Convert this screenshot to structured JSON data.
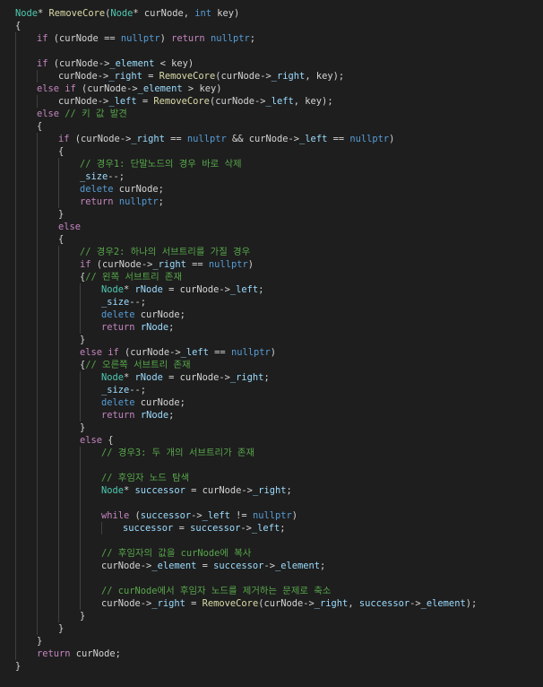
{
  "editor": {
    "lines": [
      {
        "indent": 0,
        "tokens": [
          {
            "t": "Node",
            "k": "type"
          },
          {
            "t": "* ",
            "k": "plain"
          },
          {
            "t": "RemoveCore",
            "k": "func"
          },
          {
            "t": "(",
            "k": "plain"
          },
          {
            "t": "Node",
            "k": "type"
          },
          {
            "t": "* curNode, ",
            "k": "plain"
          },
          {
            "t": "int",
            "k": "kw"
          },
          {
            "t": " key)",
            "k": "plain"
          }
        ]
      },
      {
        "indent": 0,
        "tokens": [
          {
            "t": "{",
            "k": "plain"
          }
        ]
      },
      {
        "indent": 1,
        "tokens": [
          {
            "t": "if",
            "k": "ctrl"
          },
          {
            "t": " (curNode == ",
            "k": "plain"
          },
          {
            "t": "nullptr",
            "k": "kw"
          },
          {
            "t": ") ",
            "k": "plain"
          },
          {
            "t": "return",
            "k": "ctrl"
          },
          {
            "t": " ",
            "k": "plain"
          },
          {
            "t": "nullptr",
            "k": "kw"
          },
          {
            "t": ";",
            "k": "plain"
          }
        ]
      },
      {
        "indent": 1,
        "tokens": []
      },
      {
        "indent": 1,
        "tokens": [
          {
            "t": "if",
            "k": "ctrl"
          },
          {
            "t": " (curNode->",
            "k": "plain"
          },
          {
            "t": "_element",
            "k": "var"
          },
          {
            "t": " < key)",
            "k": "plain"
          }
        ]
      },
      {
        "indent": 2,
        "tokens": [
          {
            "t": "curNode->",
            "k": "plain"
          },
          {
            "t": "_right",
            "k": "var"
          },
          {
            "t": " = ",
            "k": "plain"
          },
          {
            "t": "RemoveCore",
            "k": "func"
          },
          {
            "t": "(curNode->",
            "k": "plain"
          },
          {
            "t": "_right",
            "k": "var"
          },
          {
            "t": ", key);",
            "k": "plain"
          }
        ]
      },
      {
        "indent": 1,
        "tokens": [
          {
            "t": "else if",
            "k": "ctrl"
          },
          {
            "t": " (curNode->",
            "k": "plain"
          },
          {
            "t": "_element",
            "k": "var"
          },
          {
            "t": " > key)",
            "k": "plain"
          }
        ]
      },
      {
        "indent": 2,
        "tokens": [
          {
            "t": "curNode->",
            "k": "plain"
          },
          {
            "t": "_left",
            "k": "var"
          },
          {
            "t": " = ",
            "k": "plain"
          },
          {
            "t": "RemoveCore",
            "k": "func"
          },
          {
            "t": "(curNode->",
            "k": "plain"
          },
          {
            "t": "_left",
            "k": "var"
          },
          {
            "t": ", key);",
            "k": "plain"
          }
        ]
      },
      {
        "indent": 1,
        "tokens": [
          {
            "t": "else",
            "k": "ctrl"
          },
          {
            "t": " ",
            "k": "plain"
          },
          {
            "t": "// 키 값 발견",
            "k": "cmt"
          }
        ]
      },
      {
        "indent": 1,
        "tokens": [
          {
            "t": "{",
            "k": "plain"
          }
        ]
      },
      {
        "indent": 2,
        "tokens": [
          {
            "t": "if",
            "k": "ctrl"
          },
          {
            "t": " (curNode->",
            "k": "plain"
          },
          {
            "t": "_right",
            "k": "var"
          },
          {
            "t": " == ",
            "k": "plain"
          },
          {
            "t": "nullptr",
            "k": "kw"
          },
          {
            "t": " && curNode->",
            "k": "plain"
          },
          {
            "t": "_left",
            "k": "var"
          },
          {
            "t": " == ",
            "k": "plain"
          },
          {
            "t": "nullptr",
            "k": "kw"
          },
          {
            "t": ")",
            "k": "plain"
          }
        ]
      },
      {
        "indent": 2,
        "tokens": [
          {
            "t": "{",
            "k": "plain"
          }
        ]
      },
      {
        "indent": 3,
        "tokens": [
          {
            "t": "// 경우1: 단말노드의 경우 바로 삭제",
            "k": "cmt"
          }
        ]
      },
      {
        "indent": 3,
        "tokens": [
          {
            "t": "_size",
            "k": "var"
          },
          {
            "t": "--;",
            "k": "plain"
          }
        ]
      },
      {
        "indent": 3,
        "tokens": [
          {
            "t": "delete",
            "k": "kw"
          },
          {
            "t": " curNode;",
            "k": "plain"
          }
        ]
      },
      {
        "indent": 3,
        "tokens": [
          {
            "t": "return",
            "k": "ctrl"
          },
          {
            "t": " ",
            "k": "plain"
          },
          {
            "t": "nullptr",
            "k": "kw"
          },
          {
            "t": ";",
            "k": "plain"
          }
        ]
      },
      {
        "indent": 2,
        "tokens": [
          {
            "t": "}",
            "k": "plain"
          }
        ]
      },
      {
        "indent": 2,
        "tokens": [
          {
            "t": "else",
            "k": "ctrl"
          }
        ]
      },
      {
        "indent": 2,
        "tokens": [
          {
            "t": "{",
            "k": "plain"
          }
        ]
      },
      {
        "indent": 3,
        "tokens": [
          {
            "t": "// 경우2: 하나의 서브트리를 가질 경우",
            "k": "cmt"
          }
        ]
      },
      {
        "indent": 3,
        "tokens": [
          {
            "t": "if",
            "k": "ctrl"
          },
          {
            "t": " (curNode->",
            "k": "plain"
          },
          {
            "t": "_right",
            "k": "var"
          },
          {
            "t": " == ",
            "k": "plain"
          },
          {
            "t": "nullptr",
            "k": "kw"
          },
          {
            "t": ")",
            "k": "plain"
          }
        ]
      },
      {
        "indent": 3,
        "tokens": [
          {
            "t": "{",
            "k": "plain"
          },
          {
            "t": "// 왼쪽 서브트리 존재",
            "k": "cmt"
          }
        ]
      },
      {
        "indent": 4,
        "tokens": [
          {
            "t": "Node",
            "k": "type"
          },
          {
            "t": "* ",
            "k": "plain"
          },
          {
            "t": "rNode",
            "k": "var"
          },
          {
            "t": " = curNode->",
            "k": "plain"
          },
          {
            "t": "_left",
            "k": "var"
          },
          {
            "t": ";",
            "k": "plain"
          }
        ]
      },
      {
        "indent": 4,
        "tokens": [
          {
            "t": "_size",
            "k": "var"
          },
          {
            "t": "--;",
            "k": "plain"
          }
        ]
      },
      {
        "indent": 4,
        "tokens": [
          {
            "t": "delete",
            "k": "kw"
          },
          {
            "t": " curNode;",
            "k": "plain"
          }
        ]
      },
      {
        "indent": 4,
        "tokens": [
          {
            "t": "return",
            "k": "ctrl"
          },
          {
            "t": " ",
            "k": "plain"
          },
          {
            "t": "rNode",
            "k": "var"
          },
          {
            "t": ";",
            "k": "plain"
          }
        ]
      },
      {
        "indent": 3,
        "tokens": [
          {
            "t": "}",
            "k": "plain"
          }
        ]
      },
      {
        "indent": 3,
        "tokens": [
          {
            "t": "else if",
            "k": "ctrl"
          },
          {
            "t": " (curNode->",
            "k": "plain"
          },
          {
            "t": "_left",
            "k": "var"
          },
          {
            "t": " == ",
            "k": "plain"
          },
          {
            "t": "nullptr",
            "k": "kw"
          },
          {
            "t": ")",
            "k": "plain"
          }
        ]
      },
      {
        "indent": 3,
        "tokens": [
          {
            "t": "{",
            "k": "plain"
          },
          {
            "t": "// 오른쪽 서브트리 존재",
            "k": "cmt"
          }
        ]
      },
      {
        "indent": 4,
        "tokens": [
          {
            "t": "Node",
            "k": "type"
          },
          {
            "t": "* ",
            "k": "plain"
          },
          {
            "t": "rNode",
            "k": "var"
          },
          {
            "t": " = curNode->",
            "k": "plain"
          },
          {
            "t": "_right",
            "k": "var"
          },
          {
            "t": ";",
            "k": "plain"
          }
        ]
      },
      {
        "indent": 4,
        "tokens": [
          {
            "t": "_size",
            "k": "var"
          },
          {
            "t": "--;",
            "k": "plain"
          }
        ]
      },
      {
        "indent": 4,
        "tokens": [
          {
            "t": "delete",
            "k": "kw"
          },
          {
            "t": " curNode;",
            "k": "plain"
          }
        ]
      },
      {
        "indent": 4,
        "tokens": [
          {
            "t": "return",
            "k": "ctrl"
          },
          {
            "t": " ",
            "k": "plain"
          },
          {
            "t": "rNode",
            "k": "var"
          },
          {
            "t": ";",
            "k": "plain"
          }
        ]
      },
      {
        "indent": 3,
        "tokens": [
          {
            "t": "}",
            "k": "plain"
          }
        ]
      },
      {
        "indent": 3,
        "tokens": [
          {
            "t": "else",
            "k": "ctrl"
          },
          {
            "t": " {",
            "k": "plain"
          }
        ]
      },
      {
        "indent": 4,
        "tokens": [
          {
            "t": "// 경우3: 두 개의 서브트리가 존재",
            "k": "cmt"
          }
        ]
      },
      {
        "indent": 4,
        "tokens": []
      },
      {
        "indent": 4,
        "tokens": [
          {
            "t": "// 후임자 노드 탐색",
            "k": "cmt"
          }
        ]
      },
      {
        "indent": 4,
        "tokens": [
          {
            "t": "Node",
            "k": "type"
          },
          {
            "t": "* ",
            "k": "plain"
          },
          {
            "t": "successor",
            "k": "var"
          },
          {
            "t": " = curNode->",
            "k": "plain"
          },
          {
            "t": "_right",
            "k": "var"
          },
          {
            "t": ";",
            "k": "plain"
          }
        ]
      },
      {
        "indent": 4,
        "tokens": []
      },
      {
        "indent": 4,
        "tokens": [
          {
            "t": "while",
            "k": "ctrl"
          },
          {
            "t": " (",
            "k": "plain"
          },
          {
            "t": "successor",
            "k": "var"
          },
          {
            "t": "->",
            "k": "plain"
          },
          {
            "t": "_left",
            "k": "var"
          },
          {
            "t": " != ",
            "k": "plain"
          },
          {
            "t": "nullptr",
            "k": "kw"
          },
          {
            "t": ")",
            "k": "plain"
          }
        ]
      },
      {
        "indent": 5,
        "tokens": [
          {
            "t": "successor",
            "k": "var"
          },
          {
            "t": " = ",
            "k": "plain"
          },
          {
            "t": "successor",
            "k": "var"
          },
          {
            "t": "->",
            "k": "plain"
          },
          {
            "t": "_left",
            "k": "var"
          },
          {
            "t": ";",
            "k": "plain"
          }
        ]
      },
      {
        "indent": 4,
        "tokens": []
      },
      {
        "indent": 4,
        "tokens": [
          {
            "t": "// 후임자의 값을 curNode에 복사",
            "k": "cmt"
          }
        ]
      },
      {
        "indent": 4,
        "tokens": [
          {
            "t": "curNode->",
            "k": "plain"
          },
          {
            "t": "_element",
            "k": "var"
          },
          {
            "t": " = ",
            "k": "plain"
          },
          {
            "t": "successor",
            "k": "var"
          },
          {
            "t": "->",
            "k": "plain"
          },
          {
            "t": "_element",
            "k": "var"
          },
          {
            "t": ";",
            "k": "plain"
          }
        ]
      },
      {
        "indent": 4,
        "tokens": []
      },
      {
        "indent": 4,
        "tokens": [
          {
            "t": "// curNode에서 후임자 노드를 제거하는 문제로 축소",
            "k": "cmt"
          }
        ]
      },
      {
        "indent": 4,
        "tokens": [
          {
            "t": "curNode->",
            "k": "plain"
          },
          {
            "t": "_right",
            "k": "var"
          },
          {
            "t": " = ",
            "k": "plain"
          },
          {
            "t": "RemoveCore",
            "k": "func"
          },
          {
            "t": "(curNode->",
            "k": "plain"
          },
          {
            "t": "_right",
            "k": "var"
          },
          {
            "t": ", ",
            "k": "plain"
          },
          {
            "t": "successor",
            "k": "var"
          },
          {
            "t": "->",
            "k": "plain"
          },
          {
            "t": "_element",
            "k": "var"
          },
          {
            "t": ");",
            "k": "plain"
          }
        ]
      },
      {
        "indent": 3,
        "tokens": [
          {
            "t": "}",
            "k": "plain"
          }
        ]
      },
      {
        "indent": 2,
        "tokens": [
          {
            "t": "}",
            "k": "plain"
          }
        ]
      },
      {
        "indent": 1,
        "tokens": [
          {
            "t": "}",
            "k": "plain"
          }
        ]
      },
      {
        "indent": 1,
        "tokens": [
          {
            "t": "return",
            "k": "ctrl"
          },
          {
            "t": " curNode;",
            "k": "plain"
          }
        ]
      },
      {
        "indent": 0,
        "tokens": [
          {
            "t": "}",
            "k": "plain"
          }
        ]
      }
    ]
  },
  "colors": {
    "background": "#1e1e1e",
    "type": "#4ec9b0",
    "function": "#dcdcaa",
    "keyword": "#569cd6",
    "control": "#c586c0",
    "variable": "#9cdcfe",
    "comment": "#57a64a",
    "plain": "#d4d4d4",
    "indent_guide": "#404040"
  }
}
